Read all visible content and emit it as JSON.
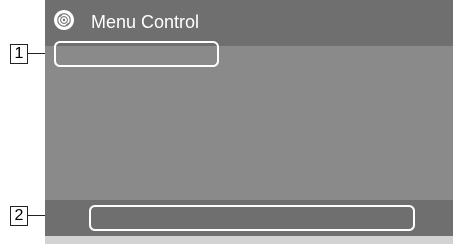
{
  "header": {
    "title": "Menu Control",
    "icon": "disc-icon"
  },
  "callouts": {
    "first": "1",
    "second": "2"
  },
  "colors": {
    "screen_background": "#8a8a8a",
    "title_bar": "#6f6f6f",
    "slot_outline": "#ffffff",
    "bottom_strip": "#d2d2d2"
  }
}
